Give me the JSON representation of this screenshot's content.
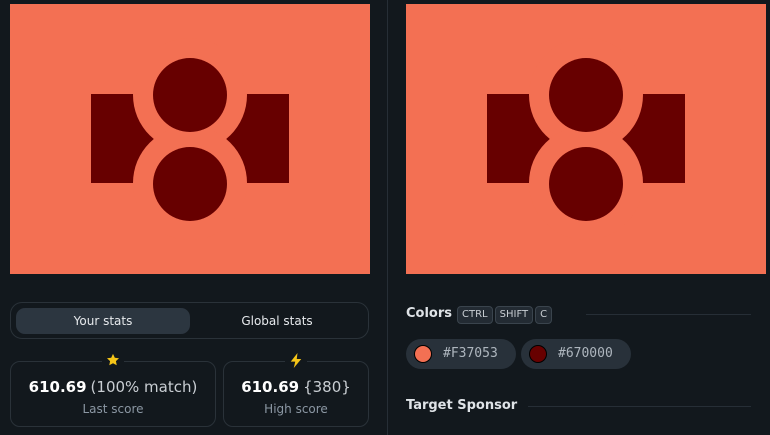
{
  "shape": {
    "background_color": "#F37053",
    "foreground_color": "#670000"
  },
  "stats_toggle": {
    "your_stats_label": "Your stats",
    "global_stats_label": "Global stats",
    "active_tab": "your_stats"
  },
  "last_score": {
    "icon": "star-icon",
    "icon_color": "#f5c518",
    "value": "610.69",
    "extra": "(100% match)",
    "label": "Last score"
  },
  "high_score": {
    "icon": "lightning-icon",
    "icon_color": "#f5c518",
    "value": "610.69",
    "extra": "{380}",
    "label": "High score"
  },
  "colors_section": {
    "title": "Colors",
    "shortcut_keys": [
      "CTRL",
      "SHIFT",
      "C"
    ],
    "swatches": [
      {
        "hex": "#F37053",
        "color": "#F37053"
      },
      {
        "hex": "#670000",
        "color": "#670000"
      }
    ]
  },
  "sponsor_section": {
    "title": "Target Sponsor"
  }
}
